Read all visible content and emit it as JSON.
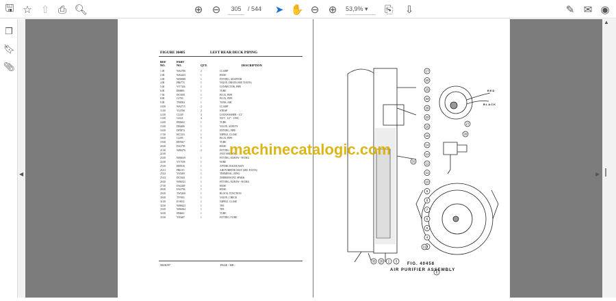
{
  "toolbar": {
    "current_page": "305",
    "total_pages": "/ 544",
    "zoom": "53,9%"
  },
  "document": {
    "figure": "FIGURE 30485",
    "title": "LEFT REAR DECK PIPING",
    "columns": {
      "ref": "REF\nNO.",
      "part": "PART\nNO.",
      "qty": "QTY.",
      "desc": "DESCRIPTION"
    },
    "rows": [
      [
        "1.00",
        "WA4786",
        "2",
        "CLAMP"
      ],
      [
        "2.00",
        "WA4443",
        "1",
        "HOSE"
      ],
      [
        "3.00",
        "WB0008",
        "1",
        "FITTING, ADAPTOR"
      ],
      [
        "4.00",
        "FB6774",
        "1",
        "VALVE, DRAIN (SEE TOOTS)"
      ],
      [
        "5.00",
        "YY7326",
        "1",
        "CONNECTOR, PIPE"
      ],
      [
        "6.00",
        "EB6881",
        "1",
        "TUBE"
      ],
      [
        "7.00",
        "DC5695",
        "1",
        "PLUG, PIPE"
      ],
      [
        "8.00",
        "C2703",
        "1",
        "PLUG, PIPE"
      ],
      [
        "9.00",
        "TN6504",
        "1",
        "TANK, AIR"
      ],
      [
        "10.00",
        "WA4715",
        "2",
        "CLAMP"
      ],
      [
        "11.00",
        "YL4766",
        "2",
        "STRAP"
      ],
      [
        "12.00",
        "C2249",
        "4",
        "LOCKWASHER - 1/2\""
      ],
      [
        "13.00",
        "C2321",
        "4",
        "NUT - 1/2\" - 13NC"
      ],
      [
        "14.00",
        "EB5662",
        "1",
        "TUBE"
      ],
      [
        "15.00",
        "DE4496",
        "1",
        "VALVE, SAFETY"
      ],
      [
        "16.00",
        "DF5874",
        "1",
        "FITTING, PIPE"
      ],
      [
        "17.00",
        "HC1181",
        "1",
        "NIPPLE, CLOSE"
      ],
      [
        "18.00",
        "C2295",
        "5",
        "PLUG, PIPE"
      ],
      [
        "19.00",
        "EB7667",
        "1",
        "TUBE"
      ],
      [
        "20.00",
        "DA3799",
        "1",
        "HOSE"
      ],
      [
        "21.00",
        "WB6276",
        "2",
        "FITTING"
      ],
      [
        "22.00",
        "",
        "",
        "(NOT SHOWN)"
      ],
      [
        "23.00",
        "WB6619",
        "1",
        "FITTING, ELBOW - 90 DEG"
      ],
      [
        "24.00",
        "YY7558",
        "1",
        "WIRE"
      ],
      [
        "25.00",
        "EB9536",
        "1",
        "AFTERCOOLER ASSY"
      ],
      [
        "25.01",
        "FB6115",
        "1",
        "  AIR PURIFIER ASSY (SEE TOOTS)"
      ],
      [
        "25.02",
        "YA5209",
        "1",
        "  TERMINAL, RING"
      ],
      [
        "25.03",
        "DC5643",
        "1",
        "  THERMOSTAT, SPARK"
      ],
      [
        "26.00",
        "WB6521",
        "1",
        "FITTING, ELBOW - 90 DEG"
      ],
      [
        "27.00",
        "DA4449",
        "1",
        "HOSE"
      ],
      [
        "28.00",
        "DA2796",
        "1",
        "HOSE"
      ],
      [
        "29.00",
        "TW3266",
        "1",
        "BLOCK, JUNCTION"
      ],
      [
        "30.00",
        "TY9181",
        "1",
        "VALVE, CHECK"
      ],
      [
        "31.00",
        "EV8011",
        "1",
        "NIPPLE, CLOSE"
      ],
      [
        "32.00",
        "WB8423",
        "1",
        "TEE"
      ],
      [
        "33.00",
        "WB6362",
        "1",
        "TEE"
      ],
      [
        "34.00",
        "EB4661",
        "1",
        "TUBE"
      ],
      [
        "35.00",
        "YE5487",
        "1",
        "FITTING, TUBE"
      ]
    ],
    "footer_left": "5023U97",
    "footer_center": "PAGE - 308 -",
    "watermark": "machinecatalogic.com",
    "fig_number": "FIG. 40458",
    "fig_title": "AIR PURIFIER ASSEMBLY",
    "wire_red": "RED",
    "wire_black": "BLACK",
    "callouts": [
      "17",
      "20",
      "25",
      "34",
      "26",
      "22",
      "16",
      "15",
      "14",
      "13",
      "12",
      "11",
      "10",
      "9",
      "8",
      "7",
      "6",
      "5",
      "4",
      "3"
    ],
    "bottom_callouts": [
      "35",
      "28",
      "2",
      "3"
    ],
    "side_callouts": [
      "29",
      "27",
      "21",
      "8",
      "33"
    ]
  }
}
